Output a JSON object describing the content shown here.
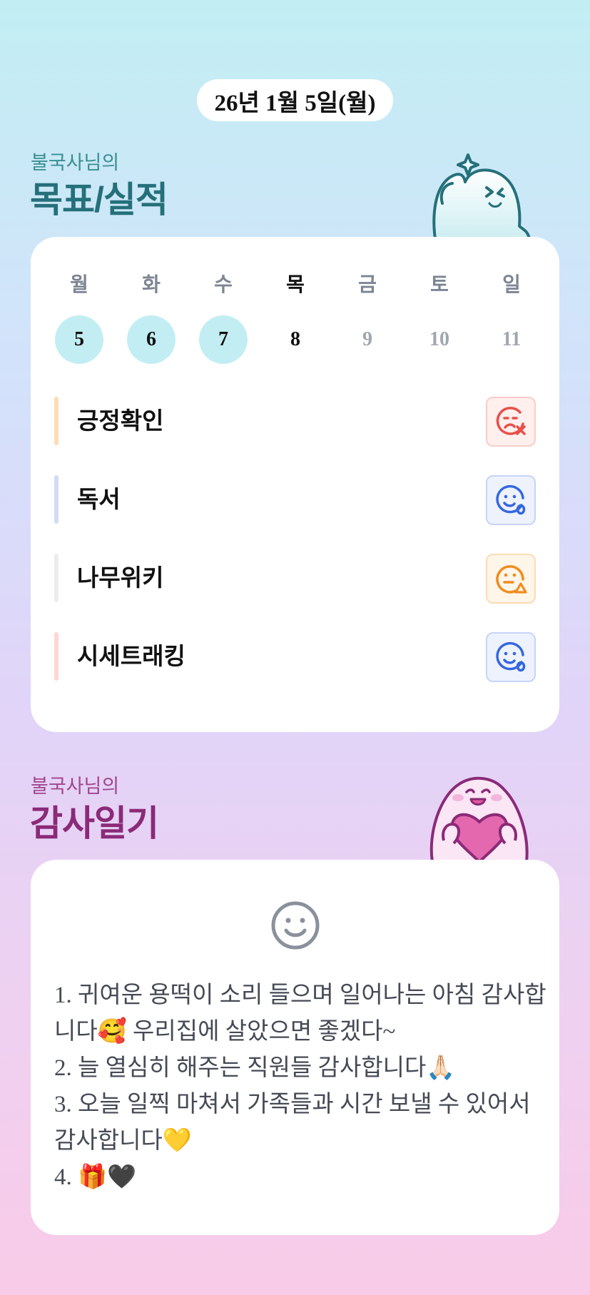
{
  "header": {
    "date": "26년 1월 5일(월)"
  },
  "goals_section": {
    "subtitle": "불국사님의",
    "title": "목표/실적",
    "days": [
      {
        "label": "월",
        "num": "5",
        "state": "done"
      },
      {
        "label": "화",
        "num": "6",
        "state": "done"
      },
      {
        "label": "수",
        "num": "7",
        "state": "done"
      },
      {
        "label": "목",
        "num": "8",
        "state": "today"
      },
      {
        "label": "금",
        "num": "9",
        "state": "future"
      },
      {
        "label": "토",
        "num": "10",
        "state": "future"
      },
      {
        "label": "일",
        "num": "11",
        "state": "future"
      }
    ],
    "goals": [
      {
        "name": "긍정확인",
        "bar_color": "#ffdcb4",
        "status_icon": "face-x-icon",
        "icon_color": "#e8504a",
        "icon_bg": "#fff0ee",
        "icon_border": "#f9cdc8"
      },
      {
        "name": "독서",
        "bar_color": "#d2dcf8",
        "status_icon": "face-o-icon",
        "icon_color": "#3466e0",
        "icon_bg": "#eef2fd",
        "icon_border": "#c8d4f6"
      },
      {
        "name": "나무위키",
        "bar_color": "#ececef",
        "status_icon": "face-triangle-icon",
        "icon_color": "#f08c1e",
        "icon_bg": "#fff6ea",
        "icon_border": "#fadcb4"
      },
      {
        "name": "시세트래킹",
        "bar_color": "#ffd6d2",
        "status_icon": "face-o-icon",
        "icon_color": "#3466e0",
        "icon_bg": "#eef2fd",
        "icon_border": "#c8d4f6"
      }
    ]
  },
  "gratitude_section": {
    "subtitle": "불국사님의",
    "title": "감사일기",
    "mood_icon": "smile-icon",
    "entries": [
      "1. 귀여운 용떡이 소리 들으며 일어나는 아침 감사합",
      "니다🥰 우리집에 살았으면 좋겠다~",
      "2. 늘 열심히 해주는 직원들 감사합니다🙏🏻",
      "3. 오늘 일찍 마쳐서 가족들과 시간 보낼 수 있어서",
      "감사합니다💛",
      "4. 🎁🖤"
    ]
  },
  "colors": {
    "accent_teal": "#25707a",
    "accent_plum": "#8b2a78",
    "done_circle": "#c2eef3"
  }
}
